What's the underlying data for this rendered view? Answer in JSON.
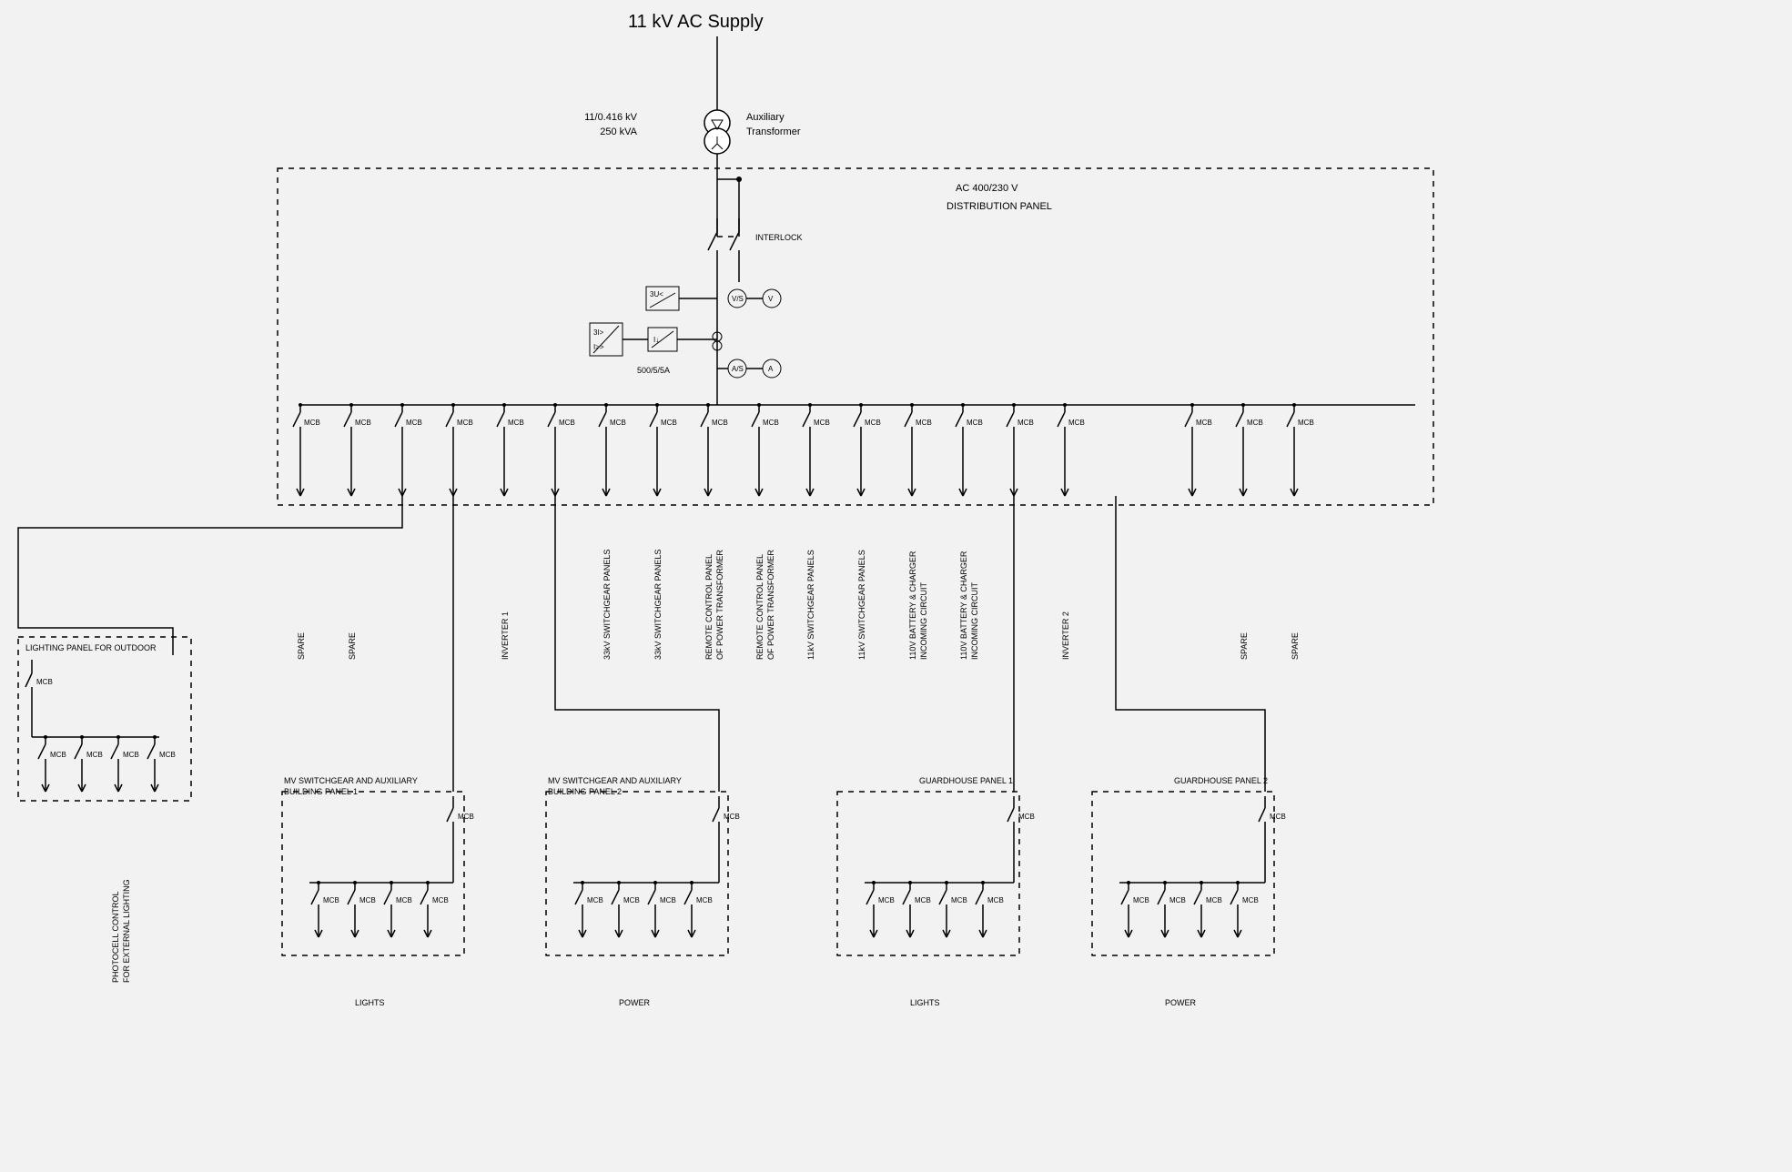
{
  "title": "11 kV AC Supply",
  "transformer": {
    "rating_line1": "11/0.416 kV",
    "rating_line2": "250 kVA",
    "label_line1": "Auxiliary",
    "label_line2": "Transformer"
  },
  "dist_panel": {
    "line1": "AC 400/230 V",
    "line2": "DISTRIBUTION PANEL",
    "interlock": "INTERLOCK",
    "relay1": "3U<",
    "relay2a": "3I>",
    "relay2b": "I>>",
    "relay3": "I↓",
    "vs": "V/S",
    "v": "V",
    "as": "A/S",
    "a": "A",
    "ct": "500/5/5A"
  },
  "mcb": "MCB",
  "feeders": [
    {
      "label": "SPARE"
    },
    {
      "label": "SPARE"
    },
    {
      "label": ""
    },
    {
      "label": ""
    },
    {
      "label": "INVERTER 1"
    },
    {
      "label": ""
    },
    {
      "label": "33kV SWITCHGEAR PANELS"
    },
    {
      "label": "33kV SWITCHGEAR PANELS"
    },
    {
      "label": "REMOTE CONTROL PANEL\nOF POWER TRANSFORMER"
    },
    {
      "label": "REMOTE CONTROL PANEL\nOF POWER TRANSFORMER"
    },
    {
      "label": "11kV SWITCHGEAR PANELS"
    },
    {
      "label": "11kV SWITCHGEAR PANELS"
    },
    {
      "label": "110V BATTERY & CHARGER\nINCOMING CIRCUIT"
    },
    {
      "label": "110V BATTERY & CHARGER\nINCOMING CIRCUIT"
    },
    {
      "label": ""
    },
    {
      "label": "INVERTER 2"
    },
    {
      "label": ""
    },
    {
      "label": "SPARE"
    },
    {
      "label": "SPARE"
    }
  ],
  "subpanels": {
    "outdoor": {
      "title": "LIGHTING PANEL FOR OUTDOOR",
      "note": "PHOTOCELL CONTROL\nFOR EXTERNAL LIGHTING"
    },
    "mv1": {
      "title": "MV SWITCHGEAR AND AUXILIARY\nBUILDING PANEL 1",
      "load": "LIGHTS"
    },
    "mv2": {
      "title": "MV SWITCHGEAR AND AUXILIARY\nBUILDING PANEL 2",
      "load": "POWER"
    },
    "gh1": {
      "title": "GUARDHOUSE PANEL 1",
      "load": "LIGHTS"
    },
    "gh2": {
      "title": "GUARDHOUSE PANEL 2",
      "load": "POWER"
    }
  }
}
